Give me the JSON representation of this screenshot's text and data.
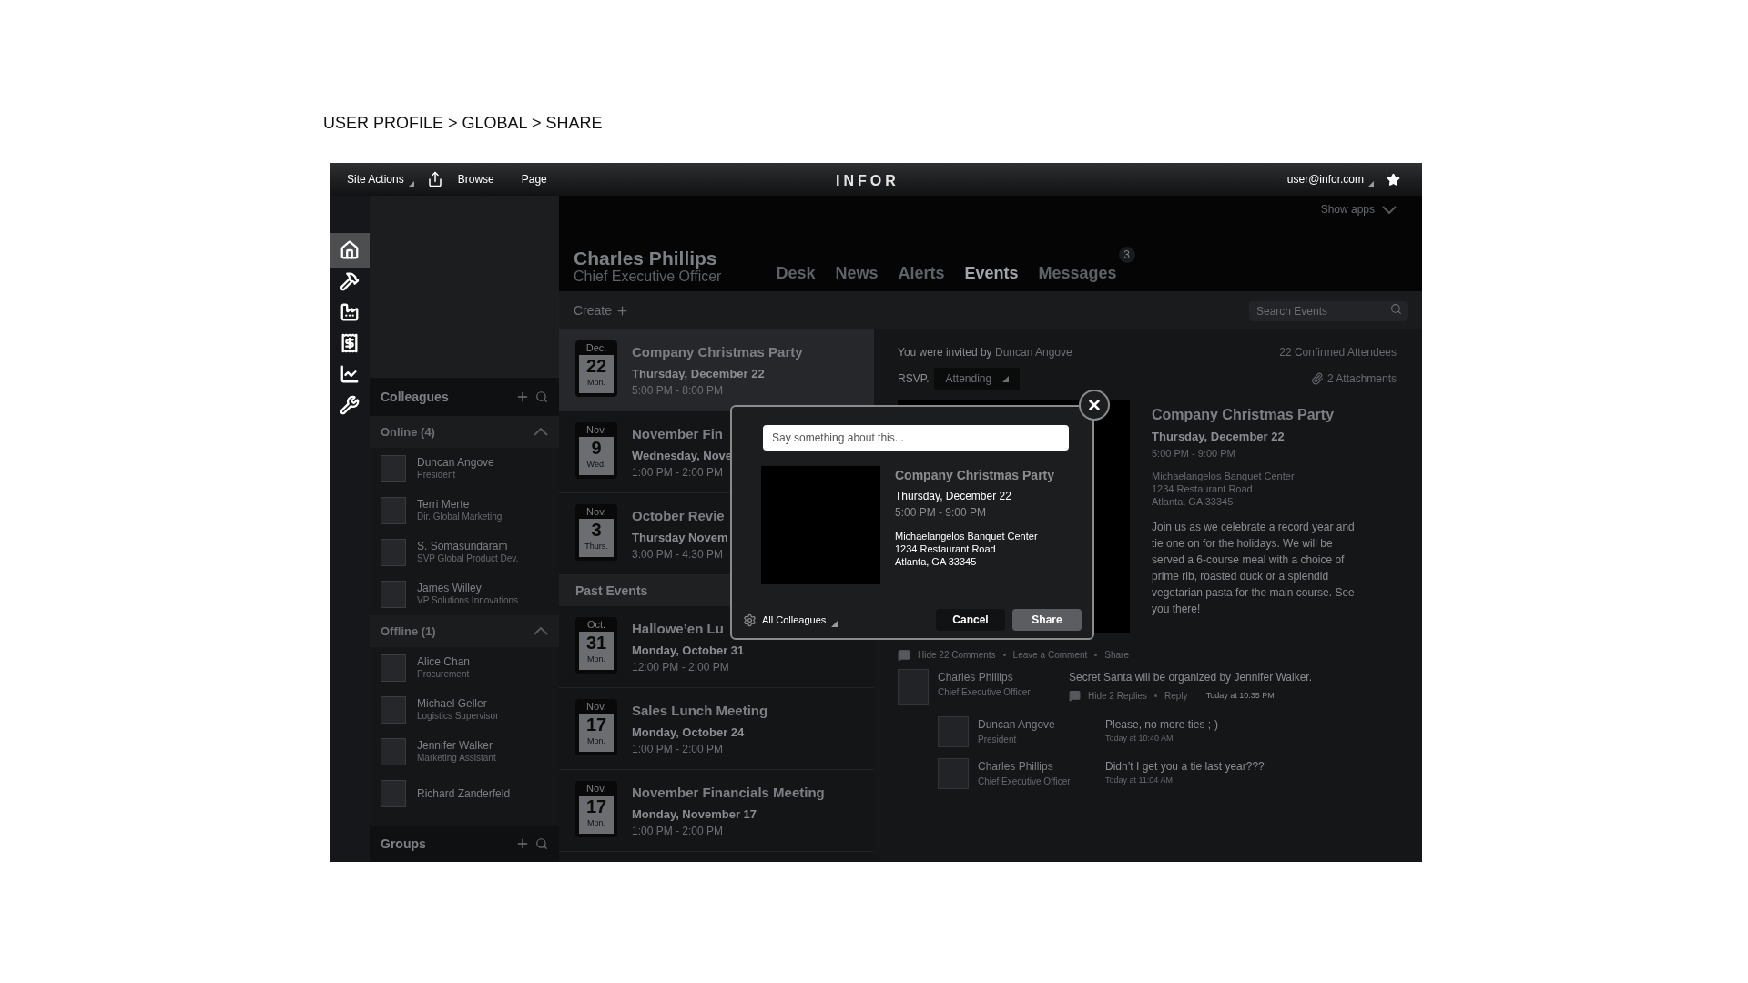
{
  "breadcrumb": "USER PROFILE > GLOBAL > SHARE",
  "top_bar": {
    "site_actions": "Site Actions",
    "links": [
      "Browse",
      "Page"
    ],
    "logo": "INFOR",
    "user": "user@infor.com"
  },
  "rail": [
    {
      "kind": "home",
      "selected": true
    },
    {
      "kind": "hammer",
      "selected": false
    },
    {
      "kind": "factory",
      "selected": false
    },
    {
      "kind": "receipt",
      "selected": false
    },
    {
      "kind": "chart",
      "selected": false
    },
    {
      "kind": "wrench",
      "selected": false
    }
  ],
  "colleagues": {
    "title": "Colleagues",
    "groups": [
      {
        "label": "Online (4)",
        "expanded": true,
        "people": [
          {
            "name": "Duncan Angove",
            "role": "President"
          },
          {
            "name": "Terri Merte",
            "role": "Dir. Global Marketing"
          },
          {
            "name": "S. Somasundaram",
            "role": "SVP Global Product Dev."
          },
          {
            "name": "James Willey",
            "role": "VP Solutions Innovations"
          }
        ]
      },
      {
        "label": "Offline (1)",
        "expanded": true,
        "people": [
          {
            "name": "Alice Chan",
            "role": "Procurement"
          },
          {
            "name": "Michael Geller",
            "role": "Logistics Supervisor"
          },
          {
            "name": "Jennifer Walker",
            "role": "Marketing Assistant"
          },
          {
            "name": "Richard Zanderfeld"
          }
        ]
      }
    ],
    "groups_title": "Groups"
  },
  "profile": {
    "name": "Charles Phillips",
    "title": "Chief Executive Officer",
    "show_apps": "Show apps"
  },
  "tabs": [
    {
      "label": "Desk",
      "selected": false
    },
    {
      "label": "News",
      "selected": false
    },
    {
      "label": "Alerts",
      "selected": false
    },
    {
      "label": "Events",
      "selected": true
    },
    {
      "label": "Messages",
      "selected": false,
      "badge": "3"
    }
  ],
  "toolbar": {
    "create": "Create",
    "search_placeholder": "Search Events"
  },
  "events": [
    {
      "month": "Dec.",
      "day": "22",
      "weekday": "Mon.",
      "title": "Company Christmas Party",
      "date": "Thursday, December 22",
      "time": "5:00 PM - 8:00 PM",
      "selected": true
    },
    {
      "month": "Nov.",
      "day": "9",
      "weekday": "Wed.",
      "title": "November Fin",
      "date": "Wednesday, Nove",
      "time": "1:00 PM - 2:00 PM",
      "selected": false
    },
    {
      "month": "Nov.",
      "day": "3",
      "weekday": "Thurs.",
      "title": "October Revie",
      "date": "Thursday Novem",
      "time": "3:00 PM - 4:30 PM",
      "selected": false
    }
  ],
  "past_title": "Past Events",
  "past_events": [
    {
      "month": "Oct.",
      "day": "31",
      "weekday": "Mon.",
      "title": "Hallowe’en Lu",
      "date": "Monday, October 31",
      "time": "12:00 PM - 2:00 PM",
      "selected": false
    },
    {
      "month": "Nov.",
      "day": "17",
      "weekday": "Mon.",
      "title": "Sales Lunch Meeting",
      "date": "Monday, October 24",
      "time": "1:00 PM - 2:00 PM",
      "selected": false
    },
    {
      "month": "Nov.",
      "day": "17",
      "weekday": "Mon.",
      "title": "November Financials Meeting",
      "date": "Monday, November 17",
      "time": "1:00 PM - 2:00 PM",
      "selected": false
    }
  ],
  "detail": {
    "invited_by": "You were invited by",
    "inviter": "Duncan Angove",
    "attendees": "22 Confirmed Attendees",
    "rsvp_label": "RSVP.",
    "rsvp": "Attending",
    "attachments": "2 Attachments",
    "title": "Company Christmas Party",
    "date": "Thursday, December 22",
    "time": "5:00 PM - 9:00 PM",
    "address": [
      "Michaelangelos Banquet Center",
      "1234 Restaurant Road",
      "Atlanta, GA 33345"
    ],
    "description": "Join us as we celebrate a record year and tie one on for the holidays. We will be served a 6-course meal with a choice of prime rib, roasted duck or a splendid vegetarian pasta for the main course. See you there!",
    "actions": [
      "Hide 22 Comments",
      "Leave a Comment",
      "Share"
    ],
    "comment": {
      "name": "Charles Phillips",
      "role": "Chief Executive Officer",
      "text": "Secret Santa will be organized by Jennifer Walker.",
      "actions": [
        "Hide 2 Replies",
        "Reply"
      ],
      "time": "Today at 10:35 PM"
    },
    "replies": [
      {
        "name": "Duncan Angove",
        "role": "President",
        "text": "Please, no more ties ;-)",
        "time": "Today at 10:40 AM"
      },
      {
        "name": "Charles Phillips",
        "role": "Chief Executive Officer",
        "text": "Didn’t I get you a tie last year???",
        "time": "Today at 11:04 AM"
      }
    ]
  },
  "modal": {
    "placeholder": "Say something about this...",
    "title": "Company Christmas Party",
    "date": "Thursday, December 22",
    "time": "5:00 PM - 9:00 PM",
    "address": [
      "Michaelangelos Banquet Center",
      "1234 Restaurant Road",
      "Atlanta, GA 33345"
    ],
    "audience": "All Colleagues",
    "buttons": [
      {
        "label": "Cancel",
        "kind": "secondary"
      },
      {
        "label": "Share",
        "kind": "primary"
      }
    ]
  }
}
